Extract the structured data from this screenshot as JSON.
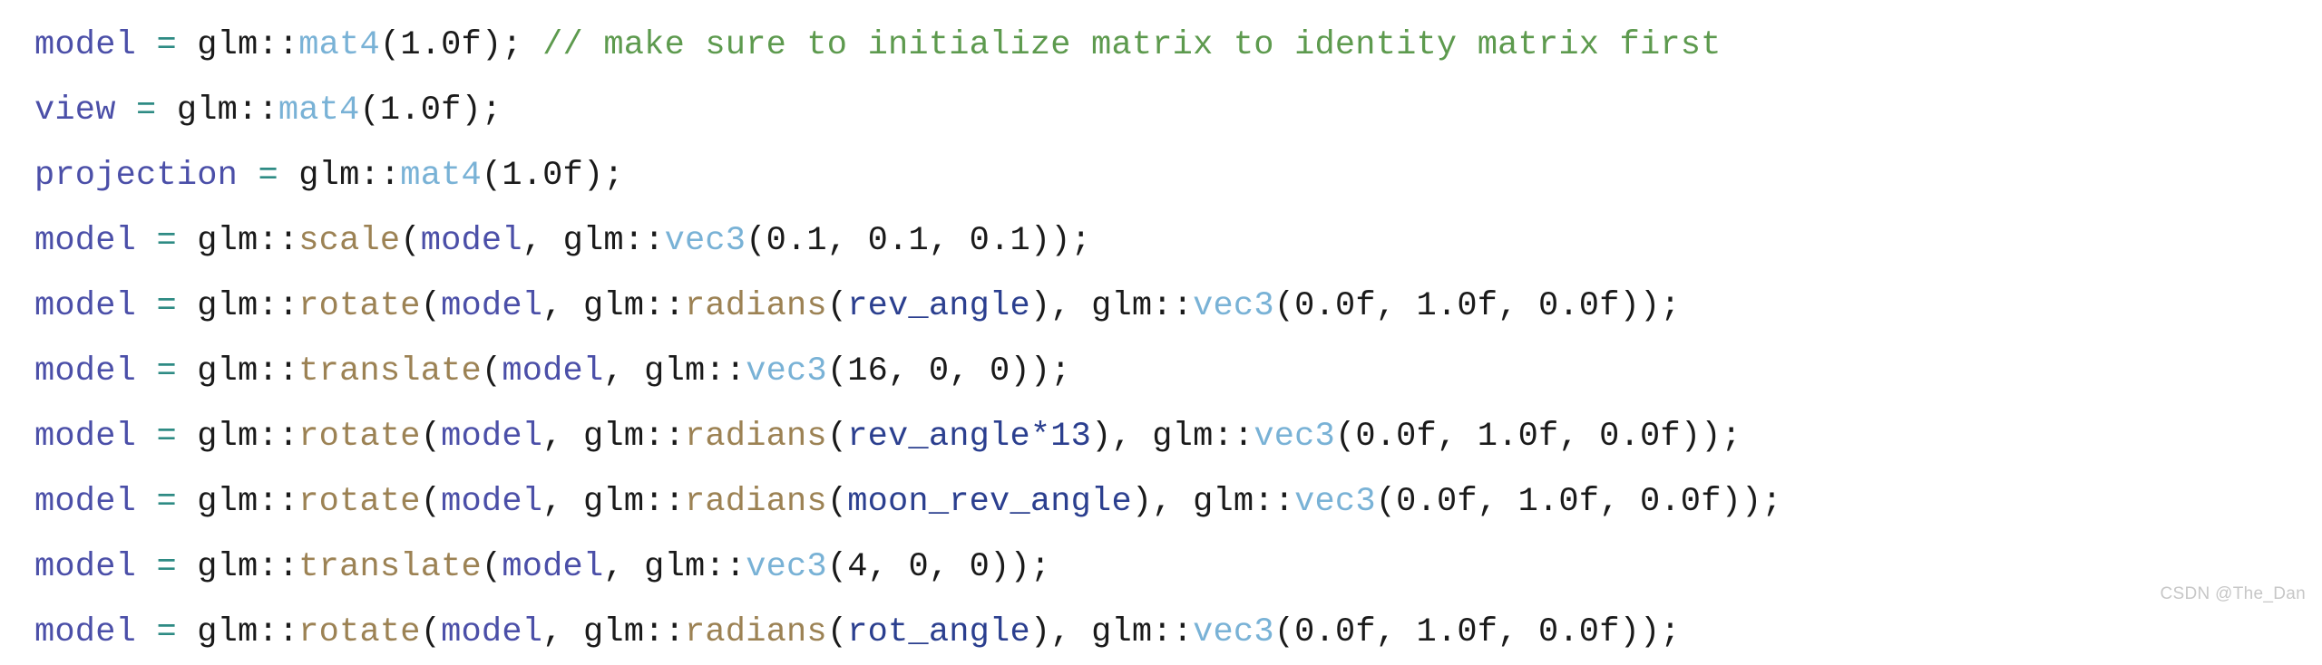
{
  "document": {
    "kind": "code-screenshot",
    "language": "C++",
    "background_color": "#ffffff"
  },
  "palette": {
    "variable": "#4b4fa8",
    "operator": "#2e8b84",
    "namespace": "#1a1a1a",
    "type": "#79b2d6",
    "function": "#9c8254",
    "number": "#1a1a1a",
    "punctuation": "#1a1a1a",
    "argument": "#2b3f8f",
    "comment": "#5d9a4e",
    "watermark": "#c7c7c7"
  },
  "code": {
    "lines": [
      {
        "id": "line-1",
        "tokens": [
          {
            "t": "model",
            "c": "tok-var"
          },
          {
            "t": " ",
            "c": "tok-punct"
          },
          {
            "t": "=",
            "c": "tok-op"
          },
          {
            "t": " ",
            "c": "tok-punct"
          },
          {
            "t": "glm::",
            "c": "tok-ns"
          },
          {
            "t": "mat4",
            "c": "tok-type"
          },
          {
            "t": "(",
            "c": "tok-punct"
          },
          {
            "t": "1.0f",
            "c": "tok-num"
          },
          {
            "t": ");",
            "c": "tok-punct"
          },
          {
            "t": " ",
            "c": "tok-punct"
          },
          {
            "t": "// make sure to initialize matrix to identity matrix first",
            "c": "tok-comment"
          }
        ]
      },
      {
        "id": "line-2",
        "tokens": [
          {
            "t": "view",
            "c": "tok-var"
          },
          {
            "t": " ",
            "c": "tok-punct"
          },
          {
            "t": "=",
            "c": "tok-op"
          },
          {
            "t": " ",
            "c": "tok-punct"
          },
          {
            "t": "glm::",
            "c": "tok-ns"
          },
          {
            "t": "mat4",
            "c": "tok-type"
          },
          {
            "t": "(",
            "c": "tok-punct"
          },
          {
            "t": "1.0f",
            "c": "tok-num"
          },
          {
            "t": ");",
            "c": "tok-punct"
          }
        ]
      },
      {
        "id": "line-3",
        "tokens": [
          {
            "t": "projection",
            "c": "tok-var"
          },
          {
            "t": " ",
            "c": "tok-punct"
          },
          {
            "t": "=",
            "c": "tok-op"
          },
          {
            "t": " ",
            "c": "tok-punct"
          },
          {
            "t": "glm::",
            "c": "tok-ns"
          },
          {
            "t": "mat4",
            "c": "tok-type"
          },
          {
            "t": "(",
            "c": "tok-punct"
          },
          {
            "t": "1.0f",
            "c": "tok-num"
          },
          {
            "t": ");",
            "c": "tok-punct"
          }
        ]
      },
      {
        "id": "line-4",
        "tokens": [
          {
            "t": "model",
            "c": "tok-var"
          },
          {
            "t": " ",
            "c": "tok-punct"
          },
          {
            "t": "=",
            "c": "tok-op"
          },
          {
            "t": " ",
            "c": "tok-punct"
          },
          {
            "t": "glm::",
            "c": "tok-ns"
          },
          {
            "t": "scale",
            "c": "tok-func"
          },
          {
            "t": "(",
            "c": "tok-punct"
          },
          {
            "t": "model",
            "c": "tok-var"
          },
          {
            "t": ", ",
            "c": "tok-punct"
          },
          {
            "t": "glm::",
            "c": "tok-ns"
          },
          {
            "t": "vec3",
            "c": "tok-type"
          },
          {
            "t": "(",
            "c": "tok-punct"
          },
          {
            "t": "0.1, 0.1, 0.1",
            "c": "tok-num"
          },
          {
            "t": "));",
            "c": "tok-punct"
          }
        ]
      },
      {
        "id": "line-5",
        "tokens": [
          {
            "t": "model",
            "c": "tok-var"
          },
          {
            "t": " ",
            "c": "tok-punct"
          },
          {
            "t": "=",
            "c": "tok-op"
          },
          {
            "t": " ",
            "c": "tok-punct"
          },
          {
            "t": "glm::",
            "c": "tok-ns"
          },
          {
            "t": "rotate",
            "c": "tok-func"
          },
          {
            "t": "(",
            "c": "tok-punct"
          },
          {
            "t": "model",
            "c": "tok-var"
          },
          {
            "t": ", ",
            "c": "tok-punct"
          },
          {
            "t": "glm::",
            "c": "tok-ns"
          },
          {
            "t": "radians",
            "c": "tok-func"
          },
          {
            "t": "(",
            "c": "tok-punct"
          },
          {
            "t": "rev_angle",
            "c": "tok-arg"
          },
          {
            "t": "), ",
            "c": "tok-punct"
          },
          {
            "t": "glm::",
            "c": "tok-ns"
          },
          {
            "t": "vec3",
            "c": "tok-type"
          },
          {
            "t": "(",
            "c": "tok-punct"
          },
          {
            "t": "0.0f, 1.0f, 0.0f",
            "c": "tok-num"
          },
          {
            "t": "));",
            "c": "tok-punct"
          }
        ]
      },
      {
        "id": "line-6",
        "tokens": [
          {
            "t": "model",
            "c": "tok-var"
          },
          {
            "t": " ",
            "c": "tok-punct"
          },
          {
            "t": "=",
            "c": "tok-op"
          },
          {
            "t": " ",
            "c": "tok-punct"
          },
          {
            "t": "glm::",
            "c": "tok-ns"
          },
          {
            "t": "translate",
            "c": "tok-func"
          },
          {
            "t": "(",
            "c": "tok-punct"
          },
          {
            "t": "model",
            "c": "tok-var"
          },
          {
            "t": ", ",
            "c": "tok-punct"
          },
          {
            "t": "glm::",
            "c": "tok-ns"
          },
          {
            "t": "vec3",
            "c": "tok-type"
          },
          {
            "t": "(",
            "c": "tok-punct"
          },
          {
            "t": "16, 0, 0",
            "c": "tok-num"
          },
          {
            "t": "));",
            "c": "tok-punct"
          }
        ]
      },
      {
        "id": "line-7",
        "tokens": [
          {
            "t": "model",
            "c": "tok-var"
          },
          {
            "t": " ",
            "c": "tok-punct"
          },
          {
            "t": "=",
            "c": "tok-op"
          },
          {
            "t": " ",
            "c": "tok-punct"
          },
          {
            "t": "glm::",
            "c": "tok-ns"
          },
          {
            "t": "rotate",
            "c": "tok-func"
          },
          {
            "t": "(",
            "c": "tok-punct"
          },
          {
            "t": "model",
            "c": "tok-var"
          },
          {
            "t": ", ",
            "c": "tok-punct"
          },
          {
            "t": "glm::",
            "c": "tok-ns"
          },
          {
            "t": "radians",
            "c": "tok-func"
          },
          {
            "t": "(",
            "c": "tok-punct"
          },
          {
            "t": "rev_angle*13",
            "c": "tok-arg"
          },
          {
            "t": "), ",
            "c": "tok-punct"
          },
          {
            "t": "glm::",
            "c": "tok-ns"
          },
          {
            "t": "vec3",
            "c": "tok-type"
          },
          {
            "t": "(",
            "c": "tok-punct"
          },
          {
            "t": "0.0f, 1.0f, 0.0f",
            "c": "tok-num"
          },
          {
            "t": "));",
            "c": "tok-punct"
          }
        ]
      },
      {
        "id": "line-8",
        "tokens": [
          {
            "t": "model",
            "c": "tok-var"
          },
          {
            "t": " ",
            "c": "tok-punct"
          },
          {
            "t": "=",
            "c": "tok-op"
          },
          {
            "t": " ",
            "c": "tok-punct"
          },
          {
            "t": "glm::",
            "c": "tok-ns"
          },
          {
            "t": "rotate",
            "c": "tok-func"
          },
          {
            "t": "(",
            "c": "tok-punct"
          },
          {
            "t": "model",
            "c": "tok-var"
          },
          {
            "t": ", ",
            "c": "tok-punct"
          },
          {
            "t": "glm::",
            "c": "tok-ns"
          },
          {
            "t": "radians",
            "c": "tok-func"
          },
          {
            "t": "(",
            "c": "tok-punct"
          },
          {
            "t": "moon_rev_angle",
            "c": "tok-arg"
          },
          {
            "t": "), ",
            "c": "tok-punct"
          },
          {
            "t": "glm::",
            "c": "tok-ns"
          },
          {
            "t": "vec3",
            "c": "tok-type"
          },
          {
            "t": "(",
            "c": "tok-punct"
          },
          {
            "t": "0.0f, 1.0f, 0.0f",
            "c": "tok-num"
          },
          {
            "t": "));",
            "c": "tok-punct"
          }
        ]
      },
      {
        "id": "line-9",
        "tokens": [
          {
            "t": "model",
            "c": "tok-var"
          },
          {
            "t": " ",
            "c": "tok-punct"
          },
          {
            "t": "=",
            "c": "tok-op"
          },
          {
            "t": " ",
            "c": "tok-punct"
          },
          {
            "t": "glm::",
            "c": "tok-ns"
          },
          {
            "t": "translate",
            "c": "tok-func"
          },
          {
            "t": "(",
            "c": "tok-punct"
          },
          {
            "t": "model",
            "c": "tok-var"
          },
          {
            "t": ", ",
            "c": "tok-punct"
          },
          {
            "t": "glm::",
            "c": "tok-ns"
          },
          {
            "t": "vec3",
            "c": "tok-type"
          },
          {
            "t": "(",
            "c": "tok-punct"
          },
          {
            "t": "4, 0, 0",
            "c": "tok-num"
          },
          {
            "t": "));",
            "c": "tok-punct"
          }
        ]
      },
      {
        "id": "line-10-clipped",
        "tokens": [
          {
            "t": "model",
            "c": "tok-var"
          },
          {
            "t": " ",
            "c": "tok-punct"
          },
          {
            "t": "=",
            "c": "tok-op"
          },
          {
            "t": " ",
            "c": "tok-punct"
          },
          {
            "t": "glm::",
            "c": "tok-ns"
          },
          {
            "t": "rotate",
            "c": "tok-func"
          },
          {
            "t": "(",
            "c": "tok-punct"
          },
          {
            "t": "model",
            "c": "tok-var"
          },
          {
            "t": ", ",
            "c": "tok-punct"
          },
          {
            "t": "glm::",
            "c": "tok-ns"
          },
          {
            "t": "radians",
            "c": "tok-func"
          },
          {
            "t": "(",
            "c": "tok-punct"
          },
          {
            "t": "rot_angle",
            "c": "tok-arg"
          },
          {
            "t": "), ",
            "c": "tok-punct"
          },
          {
            "t": "glm::",
            "c": "tok-ns"
          },
          {
            "t": "vec3",
            "c": "tok-type"
          },
          {
            "t": "(",
            "c": "tok-punct"
          },
          {
            "t": "0.0f, 1.0f, 0.0f",
            "c": "tok-num"
          },
          {
            "t": "));",
            "c": "tok-punct"
          }
        ]
      }
    ]
  },
  "watermark": {
    "text": "CSDN @The_Dan"
  }
}
